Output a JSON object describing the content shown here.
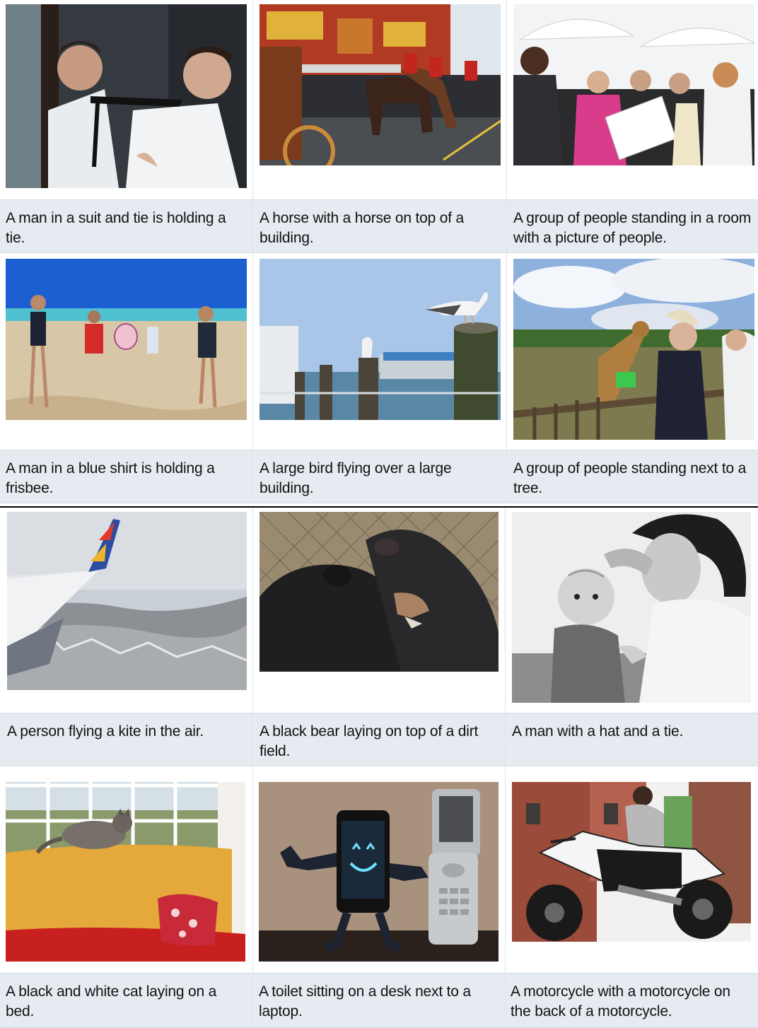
{
  "captions": [
    [
      "A man in a suit and tie is holding a tie.",
      "A horse with a horse on top of a building.",
      "A group of people standing in a room with a picture of people."
    ],
    [
      "A man in a blue shirt is holding a frisbee.",
      "A large bird flying over a large building.",
      "A group of people standing next to a tree."
    ],
    [
      "A person flying a kite in the air.",
      "A black bear laying on top of a dirt field.",
      "A man with a hat and a tie."
    ],
    [
      "A black and white cat laying on a bed.",
      "A toilet sitting on a desk next to a laptop.",
      "A motorcycle with a motorcycle on the back of a motorcycle."
    ]
  ],
  "photos": [
    [
      "two-men-tie-photo",
      "parade-horses-photo",
      "people-umbrellas-photo"
    ],
    [
      "beach-people-photo",
      "seagull-dock-photo",
      "giraffe-zoo-photo"
    ],
    [
      "airplane-wing-mountains-photo",
      "black-bears-photo",
      "mother-baby-photo"
    ],
    [
      "cat-on-couch-photo",
      "phone-robot-toy-photo",
      "motorcycle-rider-photo"
    ]
  ],
  "colors": {
    "caption_bg": "#e6ebf1",
    "separator": "#000000"
  }
}
